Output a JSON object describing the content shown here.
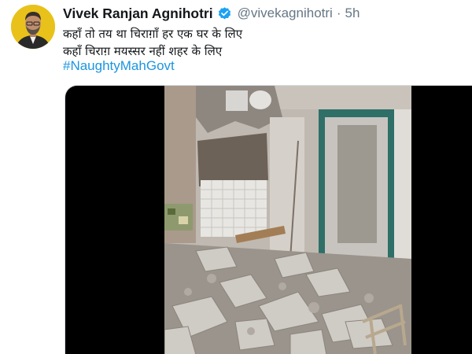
{
  "tweet": {
    "display_name": "Vivek Ranjan Agnihotri",
    "verified_icon": "verified-badge-icon",
    "handle": "@vivekagnihotri",
    "separator": "·",
    "time": "5h",
    "lines": [
      "कहाँ तो तय था चिराग़ाँ हर एक घर के लिए",
      "कहाँ चिराग़ मयस्सर नहीं शहर के लिए"
    ],
    "hashtag": "#NaughtyMahGovt"
  },
  "colors": {
    "name": "#14171a",
    "secondary": "#657786",
    "link": "#1b95e0",
    "verified": "#1da1f2",
    "avatar_bg": "#e8c21a",
    "media_bg": "#000000"
  },
  "media": {
    "type": "video",
    "content": "demolished room with rubble"
  }
}
